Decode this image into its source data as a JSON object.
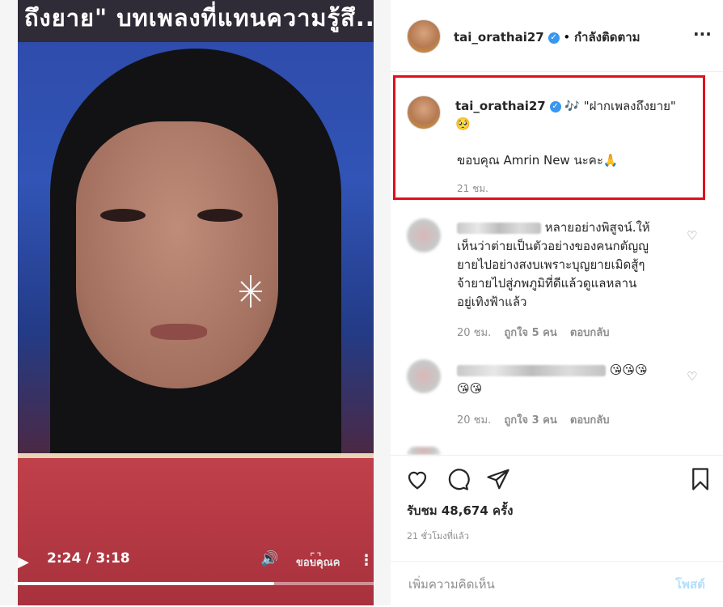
{
  "video": {
    "caption_overlay": "ถึงยาย\" บทเพลงที่แทนความรู้สึ...",
    "time_current": "2:24",
    "time_total": "3:18",
    "time_display": "2:24 / 3:18",
    "progress": 0.72,
    "watermark": "ขอบคุณค",
    "play_icon": "play-icon",
    "volume_icon": "volume-icon",
    "fullscreen_icon": "fullscreen-icon",
    "more_icon": "more-vertical-icon"
  },
  "header": {
    "username": "tai_orathai27",
    "separator": "•",
    "follow_status": "กำลังติดตาม",
    "more": "···"
  },
  "caption": {
    "username": "tai_orathai27",
    "emoji_music": "🎶",
    "text": "\"ฝากเพลงถึงยาย\"",
    "emoji_face": "🥺",
    "line2": "ขอบคุณ Amrin New นะคะ🙏",
    "time": "21 ชม."
  },
  "comments": [
    {
      "lines": [
        "หลายอย่างพิสูจน์.ให้",
        "เห็นว่าต่ายเป็นตัวอย่างของคนกตัญญู",
        "ยายไปอย่างสงบเพราะบุญยายเมิดสู้ๆ",
        "จ้ายายไปสู่ภพภูมิที่ดีแล้วดูแลหลาน",
        "อยู่เทิงฟ้าแล้ว"
      ],
      "time": "20 ชม.",
      "likes": "ถูกใจ 5 คน",
      "reply": "ตอบกลับ"
    },
    {
      "lines": [
        "😘😘😘",
        "😘😘"
      ],
      "time": "20 ชม.",
      "likes": "ถูกใจ 3 คน",
      "reply": "ตอบกลับ"
    }
  ],
  "actions": {
    "views": "รับชม 48,674 ครั้ง",
    "posted": "21 ชั่วโมงที่แล้ว"
  },
  "add_comment": {
    "placeholder": "เพิ่มความคิดเห็น",
    "post_label": "โพสต์"
  },
  "colors": {
    "verified": "#3897f0",
    "highlight_border": "#e0101b",
    "post_disabled": "#b2dffc"
  }
}
